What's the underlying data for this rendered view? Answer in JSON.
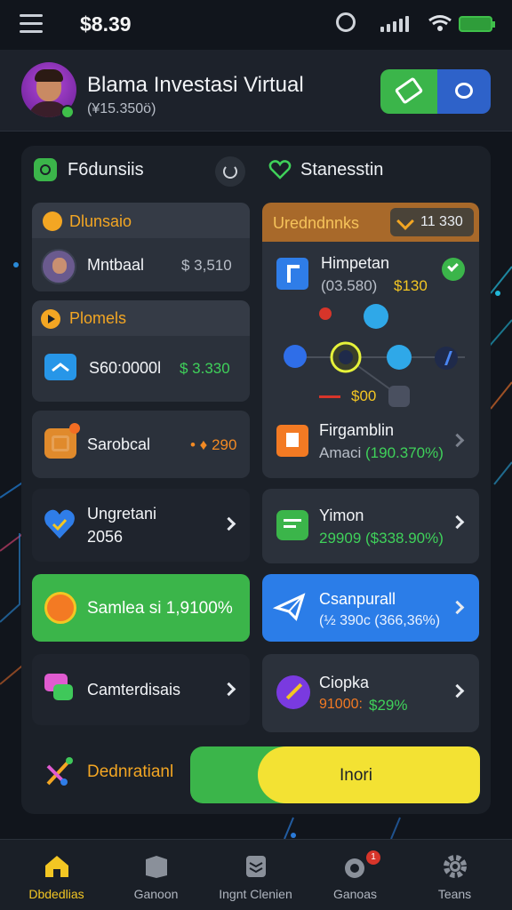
{
  "status_bar": {
    "time": "$8.39",
    "icons": [
      "alarm-icon",
      "signal-icon",
      "wifi-icon",
      "battery-icon"
    ]
  },
  "header": {
    "title": "Blama Investasi Virtual",
    "subtitle": "(¥15.350ö)",
    "buttons": [
      "ticket-icon",
      "chat-icon"
    ]
  },
  "left_section": {
    "title": "F6dunsiis",
    "cards": {
      "deposit": {
        "title": "Dlunsaio",
        "name": "Mntbaal",
        "value": "$ 3,510"
      },
      "promo": {
        "title": "Plomels",
        "name": "S60:0000l",
        "value": "$ 3.330"
      },
      "sorobcal": {
        "name": "Sarobcal",
        "value": "• ♦ 290"
      },
      "upgrade": {
        "line1": "Ungretani",
        "line2": "2056"
      },
      "samlea": {
        "label": "Samlea si 1,9100%"
      },
      "camterd": {
        "label": "Camterdisais"
      },
      "dedration": {
        "label": "Dednratianl"
      }
    }
  },
  "right_section": {
    "title": "Stanesstin",
    "cards": {
      "uredna": {
        "title": "Uredndnnks",
        "badge": "11 330"
      },
      "himpetan": {
        "name": "Himpetan",
        "value_a": "(03.580)",
        "value_b": "$130",
        "network_price": "$00"
      },
      "firgaam": {
        "name": "Firgamblin",
        "sub_a": "Amaci",
        "sub_b": "(190.370%)"
      },
      "yimon": {
        "name": "Yimon",
        "value": "29909 ($338.90%)"
      },
      "csanpurall": {
        "name": "Csanpurall",
        "value": "(½ 390c (366,36%)"
      },
      "ciopka": {
        "name": "Ciopka",
        "value_a": "91000:",
        "value_b": "$29%"
      }
    },
    "action_button": "Inori"
  },
  "bottom_nav": {
    "items": [
      {
        "label": "Dbdedlias",
        "icon": "home-icon"
      },
      {
        "label": "Ganoon",
        "icon": "box-icon"
      },
      {
        "label": "Ingnt Clenien",
        "icon": "layers-icon"
      },
      {
        "label": "Ganoas",
        "icon": "target-icon",
        "badge": "1"
      },
      {
        "label": "Teans",
        "icon": "gear-icon"
      }
    ]
  },
  "colors": {
    "accent_green": "#3bb54a",
    "accent_blue": "#2e62c9",
    "accent_orange": "#f3a623",
    "accent_yellow": "#f3e233"
  }
}
